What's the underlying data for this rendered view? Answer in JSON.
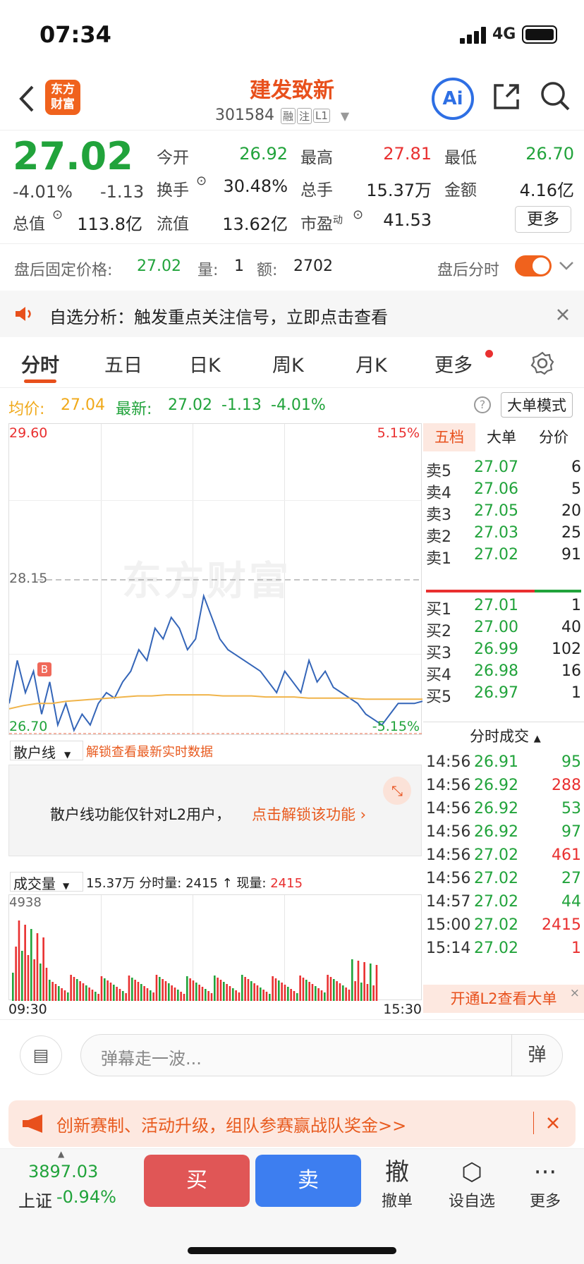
{
  "status": {
    "time": "07:34",
    "network": "4G"
  },
  "header": {
    "title": "建发致新",
    "code": "301584",
    "tags": [
      "融",
      "注",
      "L1"
    ],
    "logo_line1": "东方",
    "logo_line2": "财富",
    "ai_label": "Ai"
  },
  "quote": {
    "price": "27.02",
    "change_pct": "-4.01%",
    "change": "-1.13",
    "open_label": "今开",
    "open": "26.92",
    "high_label": "最高",
    "high": "27.81",
    "low_label": "最低",
    "low": "26.70",
    "turnover_label": "换手",
    "turnover": "30.48%",
    "volume_label": "总手",
    "volume": "15.37万",
    "amount_label": "金额",
    "amount": "4.16亿",
    "mktcap_label": "总值",
    "mktcap": "113.8亿",
    "float_label": "流值",
    "float": "13.62亿",
    "pe_label": "市盈",
    "pe_sup": "动",
    "pe": "41.53",
    "more": "更多"
  },
  "afterhours": {
    "label": "盘后固定价格:",
    "price": "27.02",
    "qty_label": "量:",
    "qty": "1",
    "amt_label": "额:",
    "amt": "2702",
    "toggle_label": "盘后分时"
  },
  "notice": {
    "text": "自选分析：触发重点关注信号，立即点击查看"
  },
  "tabs": [
    "分时",
    "五日",
    "日K",
    "周K",
    "月K",
    "更多"
  ],
  "avgline": {
    "avg_label": "均价:",
    "avg": "27.04",
    "latest_label": "最新:",
    "latest": "27.02",
    "chg": "-1.13",
    "pct": "-4.01%",
    "mode": "大单模式"
  },
  "chart_data": {
    "type": "line",
    "title": "",
    "y_max_label": "29.60",
    "y_mid_label": "28.15",
    "y_min_label": "26.70",
    "pct_max_label": "5.15%",
    "pct_min_label": "-5.15%",
    "ylim": [
      26.7,
      29.6
    ],
    "prev_close": 28.15,
    "series": [
      {
        "values": [
          27.0,
          27.4,
          27.1,
          27.3,
          26.9,
          27.2,
          26.8,
          27.0,
          26.75,
          26.9,
          26.8,
          27.0,
          27.1,
          27.05,
          27.2,
          27.3,
          27.5,
          27.4,
          27.7,
          27.6,
          27.8,
          27.7,
          27.5,
          27.6,
          28.0,
          27.8,
          27.6,
          27.5,
          27.45,
          27.4,
          27.35,
          27.3,
          27.2,
          27.1,
          27.3,
          27.2,
          27.1,
          27.4,
          27.2,
          27.3,
          27.15,
          27.1,
          27.05,
          27.0,
          26.9,
          26.85,
          26.8,
          26.9,
          27.0,
          27.0,
          27.0,
          27.02
        ]
      },
      {
        "values": [
          26.95,
          26.98,
          27.0,
          27.0,
          27.02,
          27.03,
          27.04,
          27.05,
          27.06,
          27.07,
          27.07,
          27.08,
          27.08,
          27.08,
          27.08,
          27.07,
          27.07,
          27.07,
          27.06,
          27.06,
          27.06,
          27.05,
          27.05,
          27.05,
          27.05,
          27.04,
          27.04,
          27.04,
          27.04,
          27.04
        ]
      }
    ],
    "x_start": "09:30",
    "x_end": "15:30",
    "marker": "B",
    "volume": {
      "label": "成交量",
      "total": "15.37万",
      "min_label": "分时量:",
      "min_vol": "2415",
      "cur_label": "现量:",
      "cur": "2415",
      "max_label": "4938"
    }
  },
  "sanhu": {
    "select": "散户线",
    "unlock": "解锁查看最新实时数据",
    "msg": "散户线功能仅针对L2用户，",
    "msg_link": "点击解锁该功能"
  },
  "book": {
    "tabs": [
      "五档",
      "大单",
      "分价"
    ],
    "sells": [
      [
        "卖5",
        "27.07",
        "6"
      ],
      [
        "卖4",
        "27.06",
        "5"
      ],
      [
        "卖3",
        "27.05",
        "20"
      ],
      [
        "卖2",
        "27.03",
        "25"
      ],
      [
        "卖1",
        "27.02",
        "91"
      ]
    ],
    "buys": [
      [
        "买1",
        "27.01",
        "1"
      ],
      [
        "买2",
        "27.00",
        "40"
      ],
      [
        "买3",
        "26.99",
        "102"
      ],
      [
        "买4",
        "26.98",
        "16"
      ],
      [
        "买5",
        "26.97",
        "1"
      ]
    ],
    "ticks_title": "分时成交",
    "ticks": [
      [
        "14:56",
        "26.91",
        "95",
        "g"
      ],
      [
        "14:56",
        "26.92",
        "288",
        "r"
      ],
      [
        "14:56",
        "26.92",
        "53",
        "g"
      ],
      [
        "14:56",
        "26.92",
        "97",
        "g"
      ],
      [
        "14:56",
        "27.02",
        "461",
        "r"
      ],
      [
        "14:56",
        "27.02",
        "27",
        "g"
      ],
      [
        "14:57",
        "27.02",
        "44",
        "g"
      ],
      [
        "15:00",
        "27.02",
        "2415",
        "r"
      ],
      [
        "15:14",
        "27.02",
        "1",
        "r"
      ]
    ],
    "l2": "开通L2查看大单"
  },
  "comment": {
    "placeholder": "弹幕走一波...",
    "send": "弹"
  },
  "promo": {
    "text": "创新赛制、活动升级，组队参赛赢战队奖金>>"
  },
  "bottom": {
    "index_value": "3897.03",
    "index_name": "上证",
    "index_pct": "-0.94%",
    "buy": "买",
    "sell": "卖",
    "cancel_icon": "撤",
    "cancel": "撤单",
    "watch": "设自选",
    "more": "更多"
  }
}
